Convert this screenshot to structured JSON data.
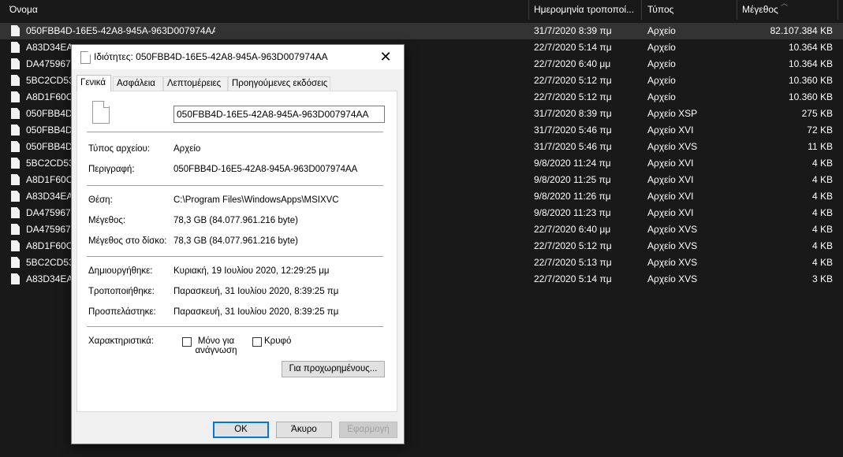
{
  "columns": {
    "name": "Όνομα",
    "date": "Ημερομηνία τροποποί...",
    "type": "Τύπος",
    "size": "Μέγεθος"
  },
  "files": [
    {
      "name": "050FBB4D-16E5-42A8-945A-963D007974AA",
      "date": "31/7/2020 8:39 πμ",
      "type": "Αρχείο",
      "size": "82.107.384 KB",
      "selected": true
    },
    {
      "name": "A83D34EA-",
      "date": "22/7/2020 5:14 πμ",
      "type": "Αρχείο",
      "size": "10.364 KB"
    },
    {
      "name": "DA475967-",
      "date": "22/7/2020 6:40 μμ",
      "type": "Αρχείο",
      "size": "10.364 KB"
    },
    {
      "name": "5BC2CD53",
      "date": "22/7/2020 5:12 πμ",
      "type": "Αρχείο",
      "size": "10.360 KB"
    },
    {
      "name": "A8D1F60C-",
      "date": "22/7/2020 5:12 πμ",
      "type": "Αρχείο",
      "size": "10.360 KB"
    },
    {
      "name": "050FBB4D-",
      "date": "31/7/2020 8:39 πμ",
      "type": "Αρχείο XSP",
      "size": "275 KB"
    },
    {
      "name": "050FBB4D-",
      "date": "31/7/2020 5:46 πμ",
      "type": "Αρχείο XVI",
      "size": "72 KB"
    },
    {
      "name": "050FBB4D-",
      "date": "31/7/2020 5:46 πμ",
      "type": "Αρχείο XVS",
      "size": "11 KB"
    },
    {
      "name": "5BC2CD53",
      "date": "9/8/2020 11:24 πμ",
      "type": "Αρχείο XVI",
      "size": "4 KB"
    },
    {
      "name": "A8D1F60C-",
      "date": "9/8/2020 11:25 πμ",
      "type": "Αρχείο XVI",
      "size": "4 KB"
    },
    {
      "name": "A83D34EA-",
      "date": "9/8/2020 11:26 πμ",
      "type": "Αρχείο XVI",
      "size": "4 KB"
    },
    {
      "name": "DA475967-",
      "date": "9/8/2020 11:23 πμ",
      "type": "Αρχείο XVI",
      "size": "4 KB"
    },
    {
      "name": "DA475967-",
      "date": "22/7/2020 6:40 μμ",
      "type": "Αρχείο XVS",
      "size": "4 KB"
    },
    {
      "name": "A8D1F60C-",
      "date": "22/7/2020 5:12 πμ",
      "type": "Αρχείο XVS",
      "size": "4 KB"
    },
    {
      "name": "5BC2CD53",
      "date": "22/7/2020 5:13 πμ",
      "type": "Αρχείο XVS",
      "size": "4 KB"
    },
    {
      "name": "A83D34EA-",
      "date": "22/7/2020 5:14 πμ",
      "type": "Αρχείο XVS",
      "size": "3 KB"
    }
  ],
  "dialog": {
    "title": "Ιδιότητες: 050FBB4D-16E5-42A8-945A-963D007974AA",
    "close_glyph": "✕",
    "tabs": [
      "Γενικά",
      "Ασφάλεια",
      "Λεπτομέρειες",
      "Προηγούμενες εκδόσεις"
    ],
    "filename": "050FBB4D-16E5-42A8-945A-963D007974AA",
    "type_label": "Τύπος αρχείου:",
    "type_value": "Αρχείο",
    "description_label": "Περιγραφή:",
    "description_value": "050FBB4D-16E5-42A8-945A-963D007974AA",
    "location_label": "Θέση:",
    "location_value": "C:\\Program Files\\WindowsApps\\MSIXVC",
    "size_label": "Μέγεθος:",
    "size_value": "78,3 GB (84.077.961.216 byte)",
    "size_on_disk_label": "Μέγεθος στο δίσκο:",
    "size_on_disk_value": "78,3 GB (84.077.961.216 byte)",
    "created_label": "Δημιουργήθηκε:",
    "created_value": "Κυριακή, 19 Ιουλίου 2020, 12:29:25 μμ",
    "modified_label": "Τροποποιήθηκε:",
    "modified_value": "Παρασκευή, 31 Ιουλίου 2020, 8:39:25 πμ",
    "accessed_label": "Προσπελάστηκε:",
    "accessed_value": "Παρασκευή, 31 Ιουλίου 2020, 8:39:25 πμ",
    "attributes_label": "Χαρακτηριστικά:",
    "readonly_label": "Μόνο για ανάγνωση",
    "hidden_label": "Κρυφό",
    "advanced_button": "Για προχωρημένους...",
    "ok_button": "ΟΚ",
    "cancel_button": "Άκυρο",
    "apply_button": "Εφαρμογή"
  },
  "icons": {
    "file": "file-icon",
    "close": "close-icon",
    "sort": "sort-up-icon"
  }
}
